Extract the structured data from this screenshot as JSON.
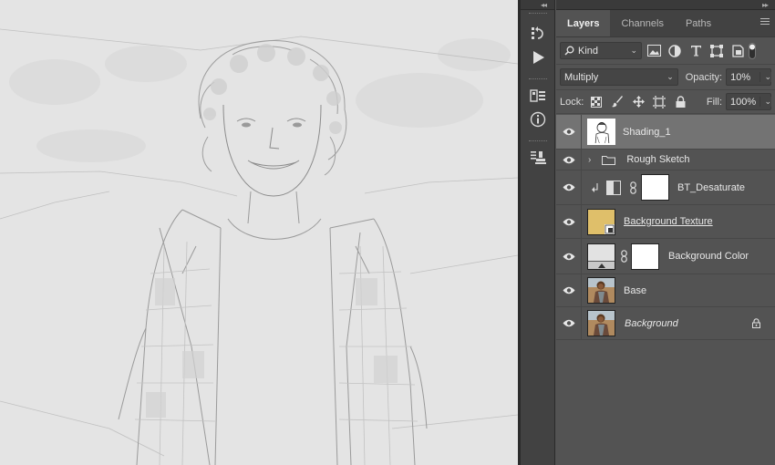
{
  "panel": {
    "tabs": [
      {
        "label": "Layers",
        "active": true
      },
      {
        "label": "Channels",
        "active": false
      },
      {
        "label": "Paths",
        "active": false
      }
    ],
    "filter": {
      "kind_label": "Kind"
    },
    "blend": {
      "mode": "Multiply",
      "opacity_label": "Opacity:",
      "opacity_value": "10%"
    },
    "lock": {
      "label": "Lock:",
      "fill_label": "Fill:",
      "fill_value": "100%"
    },
    "layers": [
      {
        "name": "Shading_1",
        "selected": true,
        "type": "pixel"
      },
      {
        "name": "Rough Sketch",
        "type": "group"
      },
      {
        "name": "BT_Desaturate",
        "type": "adjustment-clipped"
      },
      {
        "name": "Background Texture",
        "type": "smart-object"
      },
      {
        "name": "Background Color",
        "type": "fill"
      },
      {
        "name": "Base",
        "type": "pixel"
      },
      {
        "name": "Background",
        "type": "pixel",
        "locked": true
      }
    ]
  },
  "colors": {
    "panel_bg": "#535353",
    "selected_row": "#737373",
    "canvas_bg": "#e4e4e4",
    "texture_swatch": "#dfbf6a"
  },
  "icons": [
    "history-icon",
    "play-icon",
    "properties-icon",
    "info-icon",
    "clone-source-icon",
    "eye-icon",
    "lock-icon",
    "folder-icon",
    "chain-link-icon"
  ]
}
